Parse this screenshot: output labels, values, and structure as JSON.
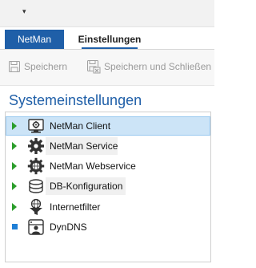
{
  "quick_access": {
    "arrow": "▾"
  },
  "tabs": [
    {
      "label": "NetMan"
    },
    {
      "label": "Einstellungen"
    }
  ],
  "ribbon": {
    "save_label": "Speichern",
    "save_close_label": "Speichern und Schließen"
  },
  "section": {
    "title": "Systemeinstellungen"
  },
  "tree": {
    "items": [
      {
        "label": "NetMan Client",
        "icon": "monitor-gear-icon"
      },
      {
        "label": "NetMan Service",
        "icon": "gear-icon"
      },
      {
        "label": "NetMan Webservice",
        "icon": "globe-gear-icon"
      },
      {
        "label": "DB-Konfiguration",
        "icon": "database-icon"
      },
      {
        "label": "Internetfilter",
        "icon": "funnel-icon"
      },
      {
        "label": "DynDNS",
        "icon": "server-user-icon"
      }
    ],
    "selected_index": 0
  },
  "colors": {
    "accent": "#1f5fa8",
    "selection": "#cce4f7",
    "expander": "#2a9d2a"
  }
}
